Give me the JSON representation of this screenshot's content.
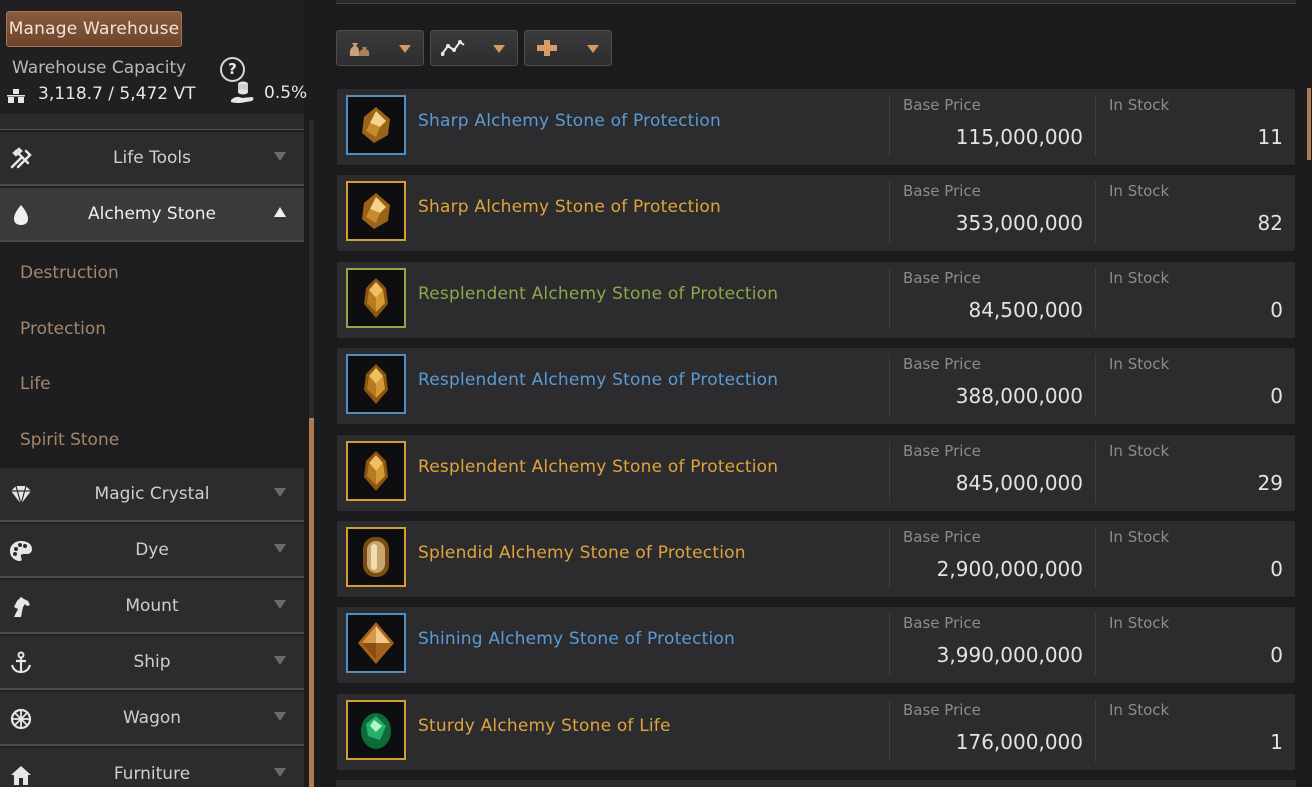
{
  "sidebar": {
    "manage_button": "Manage Warehouse",
    "capacity_label": "Warehouse Capacity",
    "capacity_value": "3,118.7 / 5,472 VT",
    "percent_value": "0.5%",
    "menu": [
      {
        "label": "Life Tools",
        "icon": "hammer-icon",
        "state": "collapsed"
      },
      {
        "label": "Alchemy Stone",
        "icon": "alchemy-stone-icon",
        "state": "expanded"
      },
      {
        "label": "Magic Crystal",
        "icon": "diamond-icon",
        "state": "collapsed"
      },
      {
        "label": "Dye",
        "icon": "palette-icon",
        "state": "collapsed"
      },
      {
        "label": "Mount",
        "icon": "horse-icon",
        "state": "collapsed"
      },
      {
        "label": "Ship",
        "icon": "anchor-icon",
        "state": "collapsed"
      },
      {
        "label": "Wagon",
        "icon": "wheel-icon",
        "state": "collapsed"
      },
      {
        "label": "Furniture",
        "icon": "house-icon",
        "state": "collapsed"
      }
    ],
    "submenu": [
      "Destruction",
      "Protection",
      "Life",
      "Spirit Stone"
    ]
  },
  "filters": [
    {
      "icon": "bag-icon"
    },
    {
      "icon": "graph-icon"
    },
    {
      "icon": "plus-icon"
    }
  ],
  "columns": {
    "price": "Base Price",
    "stock": "In Stock"
  },
  "items": [
    {
      "name": "Sharp Alchemy Stone of Protection",
      "grade": "blue",
      "price": "115,000,000",
      "stock": "11",
      "icon": "sharp-stone-icon"
    },
    {
      "name": "Sharp Alchemy Stone of Protection",
      "grade": "yellow",
      "price": "353,000,000",
      "stock": "82",
      "icon": "sharp-stone-icon"
    },
    {
      "name": "Resplendent Alchemy Stone of Protection",
      "grade": "green",
      "price": "84,500,000",
      "stock": "0",
      "icon": "resplendent-stone-icon"
    },
    {
      "name": "Resplendent Alchemy Stone of Protection",
      "grade": "blue",
      "price": "388,000,000",
      "stock": "0",
      "icon": "resplendent-stone-icon"
    },
    {
      "name": "Resplendent Alchemy Stone of Protection",
      "grade": "yellow",
      "price": "845,000,000",
      "stock": "29",
      "icon": "resplendent-stone-icon"
    },
    {
      "name": "Splendid Alchemy Stone of Protection",
      "grade": "yellow",
      "price": "2,900,000,000",
      "stock": "0",
      "icon": "splendid-stone-icon"
    },
    {
      "name": "Shining Alchemy Stone of Protection",
      "grade": "blue",
      "price": "3,990,000,000",
      "stock": "0",
      "icon": "shining-stone-icon"
    },
    {
      "name": "Sturdy Alchemy Stone of Life",
      "grade": "yellow",
      "price": "176,000,000",
      "stock": "1",
      "icon": "sturdy-life-stone-icon"
    }
  ],
  "colors": {
    "grade_blue": "#5a9bd5",
    "grade_yellow": "#e0a43b",
    "grade_green": "#8ca84a",
    "accent": "#b07a50"
  }
}
